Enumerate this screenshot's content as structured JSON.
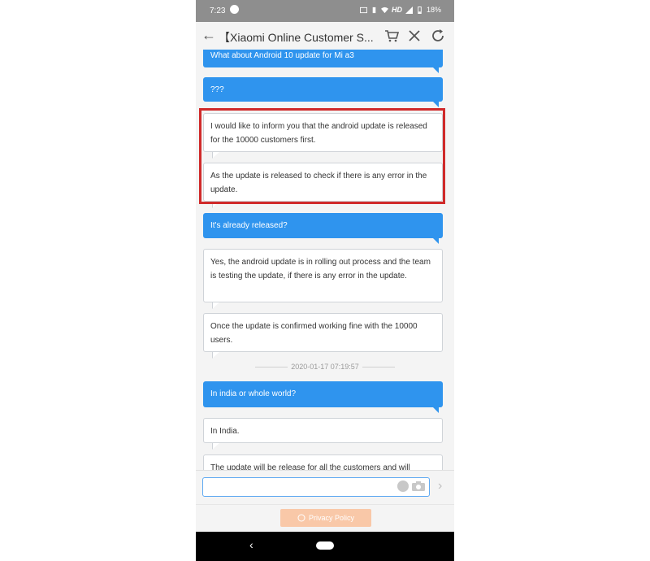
{
  "status_bar": {
    "time": "7:23",
    "network": "HD",
    "battery": "18%"
  },
  "app_bar": {
    "title": "【Xiaomi Online Customer S..."
  },
  "messages": [
    {
      "side": "out",
      "text": "What about Android 10 update for Mi a3"
    },
    {
      "side": "out",
      "text": "???"
    },
    {
      "side": "in",
      "text": "I would like to inform you that the android update is released for the 10000 customers first."
    },
    {
      "side": "in",
      "text": "As the update is released to check if there is any error in the update."
    },
    {
      "side": "out",
      "text": "It's already released?"
    },
    {
      "side": "in",
      "text": "Yes, the android update is in rolling out process and the team is testing the update, if there is any error in the update."
    },
    {
      "side": "in",
      "text": "Once the update is confirmed working fine with the 10000 users."
    },
    {
      "side": "out",
      "text": "In india or whole world?"
    },
    {
      "side": "in",
      "text": "In India."
    },
    {
      "side": "in",
      "text": "The update will be release for all the customers and will"
    }
  ],
  "timestamp": "2020-01-17 07:19:57",
  "input": {
    "value": "",
    "placeholder": ""
  },
  "footer": {
    "privacy_label": "Privacy Policy"
  },
  "colors": {
    "outgoing_bubble": "#2f94ee",
    "highlight_border": "#d02a2a",
    "privacy_button": "#f9c8a8"
  }
}
